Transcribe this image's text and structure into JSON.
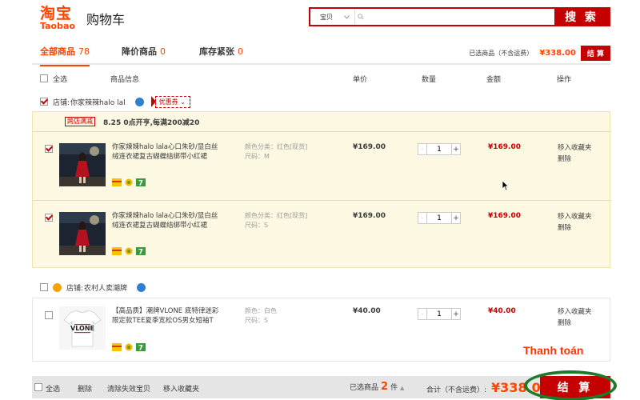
{
  "brand": {
    "cn": "淘宝",
    "en": "Taobao"
  },
  "page_title": "购物车",
  "search": {
    "category": "宝贝",
    "value": "",
    "button": "搜 索"
  },
  "tabs": [
    {
      "label": "全部商品",
      "count": "78"
    },
    {
      "label": "降价商品",
      "count": "0"
    },
    {
      "label": "库存紧张",
      "count": "0"
    }
  ],
  "summary": {
    "label": "已选商品（不含运费）",
    "price": "¥338.00",
    "checkout": "结 算"
  },
  "table_headers": {
    "select_all": "全选",
    "info": "商品信息",
    "unit_price": "单价",
    "qty": "数量",
    "amount": "金额",
    "ops": "操作"
  },
  "shops": [
    {
      "name": "店铺:",
      "owner": "你家辣辣halo lal",
      "coupon": "优惠券",
      "promo_badge": "跨店满减",
      "promo_text": "8.25 0点开亨,每满200减20",
      "items": [
        {
          "title": "你家辣辣halo lala心口朱砂/显白丝绒连衣裙复古蝴蝶结绑带小红裙",
          "sku_color": "颜色分类：红色[现货]",
          "sku_size": "尺码：M",
          "unit_price": "¥169.00",
          "qty": "1",
          "amount": "¥169.00",
          "op_fav": "移入收藏夹",
          "op_delete": "删除"
        },
        {
          "title": "你家辣辣halo lala心口朱砂/显白丝绒连衣裙复古蝴蝶结绑带小红裙",
          "sku_color": "颜色分类：红色[现货]",
          "sku_size": "尺码：S",
          "unit_price": "¥169.00",
          "qty": "1",
          "amount": "¥169.00",
          "op_fav": "移入收藏夹",
          "op_delete": "删除"
        }
      ]
    },
    {
      "name": "店铺:",
      "owner": "农村人卖潮牌",
      "items": [
        {
          "title": "【高品质】潮牌VLONE 底特律迷彩限定款TEE夏季宽松OS男女短袖T",
          "sku_color": "颜色：白色",
          "sku_size": "尺码：S",
          "unit_price": "¥40.00",
          "qty": "1",
          "amount": "¥40.00",
          "op_fav": "移入收藏夹",
          "op_delete": "删除"
        }
      ]
    }
  ],
  "annotation": "Thanh toán",
  "footer": {
    "select_all": "全选",
    "delete": "删除",
    "clear_invalid": "清除失效宝贝",
    "move_fav": "移入收藏夹",
    "selected_label": "已选商品",
    "selected_count": "2",
    "selected_unit": "件",
    "total_label": "合计（不含运费）:",
    "total": "¥338.00",
    "checkout": "结 算"
  },
  "colors": {
    "accent": "#ff4400",
    "brand_red": "#c40000",
    "shop_bg": "#fcf8e2",
    "ring": "#1c7a2a"
  }
}
